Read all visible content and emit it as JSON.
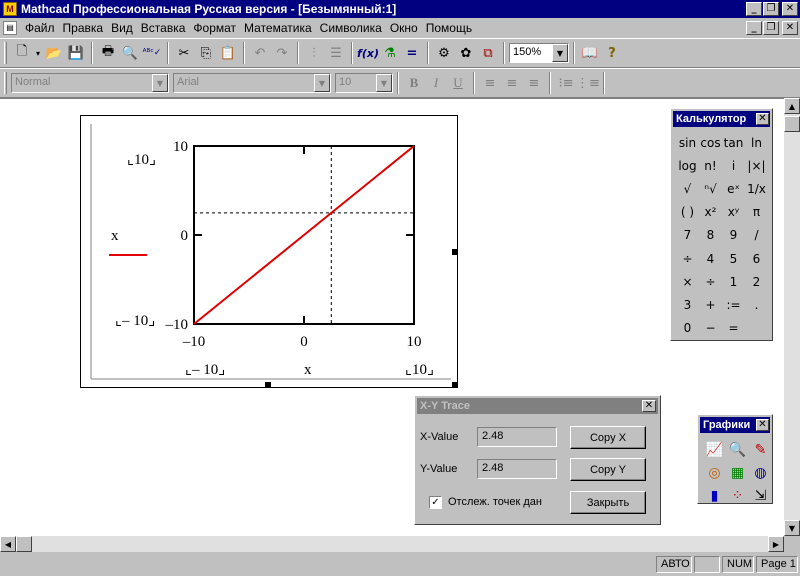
{
  "window": {
    "title": "Mathcad Профессиональная Русская версия - [Безымянный:1]",
    "buttons": {
      "minimize": "_",
      "restore": "❐",
      "close": "✕"
    }
  },
  "menu": [
    {
      "label": "Файл"
    },
    {
      "label": "Правка"
    },
    {
      "label": "Вид"
    },
    {
      "label": "Вставка"
    },
    {
      "label": "Формат"
    },
    {
      "label": "Математика"
    },
    {
      "label": "Символика"
    },
    {
      "label": "Окно"
    },
    {
      "label": "Помощь"
    }
  ],
  "toolbar": {
    "zoom": "150%",
    "icons": [
      "new-document",
      "open-folder",
      "save",
      "print",
      "print-preview",
      "spell-check",
      "cut",
      "copy",
      "paste",
      "undo",
      "redo",
      "align-horizontal",
      "align-vertical",
      "insert-function",
      "insert-unit",
      "calculate",
      "insert-component",
      "resources",
      "help"
    ]
  },
  "format_toolbar": {
    "style": "Normal",
    "font": "Arial",
    "size": "10",
    "bold": "B",
    "italic": "I",
    "underline": "U"
  },
  "plot": {
    "y_label": "x",
    "x_label": "x",
    "y_max_placeholder": "10",
    "y_min_placeholder": "– 10",
    "x_min_placeholder": "– 10",
    "x_max_placeholder": "10",
    "line_color": "#e00000"
  },
  "chart_data": {
    "type": "line",
    "series": [
      {
        "name": "x",
        "color": "#e00000",
        "x": [
          -10,
          10
        ],
        "y": [
          -10,
          10
        ]
      }
    ],
    "xlim": [
      -10,
      10
    ],
    "ylim": [
      -10,
      10
    ],
    "x_ticks": [
      "–10",
      "0",
      "10"
    ],
    "y_ticks": [
      "–10",
      "0",
      "10"
    ],
    "trace_crosshair": {
      "x": 2.48,
      "y": 2.48
    }
  },
  "calculator": {
    "title": "Калькулятор",
    "keys": [
      "sin",
      "cos",
      "tan",
      "ln",
      "log",
      "n!",
      "i",
      "|×|",
      "√",
      "ⁿ√",
      "eˣ",
      "1/x",
      "( )",
      "x²",
      "xʸ",
      "π",
      "7",
      "8",
      "9",
      "/",
      "÷",
      "4",
      "5",
      "6",
      "×",
      "÷",
      "1",
      "2",
      "3",
      "+",
      ":=",
      ".",
      "0",
      "−",
      "=",
      ""
    ]
  },
  "graphs": {
    "title": "Графики",
    "icons": [
      "xy-plot-icon",
      "zoom-icon",
      "trace-icon",
      "polar-plot-icon",
      "surface-plot-icon",
      "contour-plot-icon",
      "bar-3d-icon",
      "scatter-3d-icon",
      "vector-field-icon"
    ]
  },
  "trace": {
    "title": "X-Y Trace",
    "x_label": "X-Value",
    "x_value": "2.48",
    "y_label": "Y-Value",
    "y_value": "2.48",
    "copy_x": "Copy X",
    "copy_y": "Copy Y",
    "track_label": "Отслеж. точек дан",
    "track_checked": "✓",
    "close": "Закрыть"
  },
  "status": {
    "mode": "АВТО",
    "empty": "",
    "num": "NUM",
    "page": "Page 1"
  }
}
